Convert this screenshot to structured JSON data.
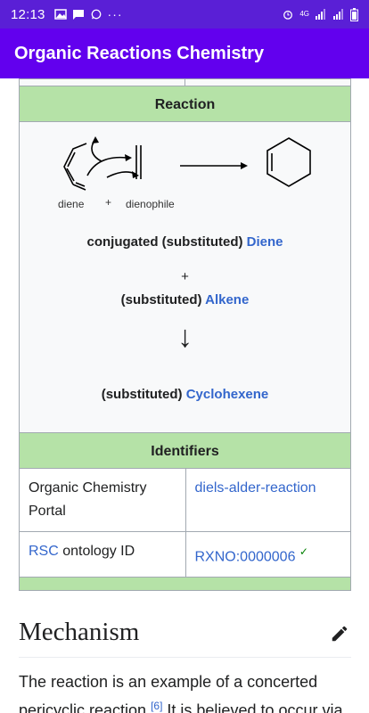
{
  "status_bar": {
    "time": "12:13",
    "left_icons": [
      "image-icon",
      "message-icon",
      "whatsapp-icon",
      "more-dots-icon"
    ],
    "right_icons": [
      "alarm-icon",
      "4g-icon",
      "signal-icon",
      "signal-icon",
      "battery-icon"
    ],
    "network": "4G"
  },
  "app_bar": {
    "title": "Organic Reactions Chemistry"
  },
  "infobox": {
    "reaction_header": "Reaction",
    "scheme_labels": {
      "diene": "diene",
      "plus": "+",
      "dienophile": "dienophile"
    },
    "line1_prefix": "conjugated (substituted) ",
    "line1_link": "Diene",
    "plus": "+",
    "line2_prefix": "(substituted) ",
    "line2_link": "Alkene",
    "arrow": "↓",
    "line3_prefix": "(substituted) ",
    "line3_link": "Cyclohexene",
    "identifiers_header": "Identifiers",
    "rows": [
      {
        "key": "Organic Chemistry Portal",
        "value": "diels-alder-reaction"
      },
      {
        "key_link": "RSC",
        "key_rest": " ontology ID",
        "value": "RXNO:0000006",
        "check": "✓"
      }
    ]
  },
  "section": {
    "title": "Mechanism",
    "para_part1": "The reaction is an example of a concerted pericyclic reaction.",
    "citation": "[6]",
    "para_part2": " It is believed to occur via a"
  },
  "colors": {
    "status_bar": "#5a1fd6",
    "app_bar": "#6200ee",
    "header_green": "#b5e2a7",
    "link": "#3366cc"
  }
}
